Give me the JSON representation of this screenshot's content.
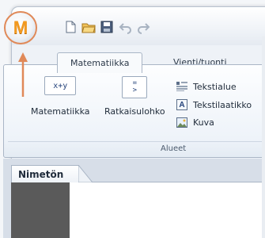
{
  "app": {
    "button_letter": "M"
  },
  "quick_access": [
    {
      "name": "new-document-icon"
    },
    {
      "name": "open-folder-icon"
    },
    {
      "name": "save-icon"
    },
    {
      "name": "undo-icon"
    },
    {
      "name": "redo-icon"
    }
  ],
  "tabs": [
    {
      "label": "Matematiikka",
      "active": true
    },
    {
      "label": "Vienti/tuonti",
      "active": false
    }
  ],
  "ribbon": {
    "big_buttons": [
      {
        "label": "Matematiikka",
        "icon_text": "x+y"
      },
      {
        "label": "Ratkaisulohko",
        "icon_text": "=\n>"
      }
    ],
    "small_buttons": [
      {
        "label": "Tekstialue"
      },
      {
        "label": "Tekstilaatikko",
        "icon_text": "A"
      },
      {
        "label": "Kuva"
      }
    ],
    "group_label": "Alueet"
  },
  "document": {
    "tab_label": "Nimetön"
  },
  "background_fragment": "x",
  "colors": {
    "app_letter": "#f39a1f",
    "annotation": "#e08958",
    "gutter": "#5a5a5a"
  }
}
